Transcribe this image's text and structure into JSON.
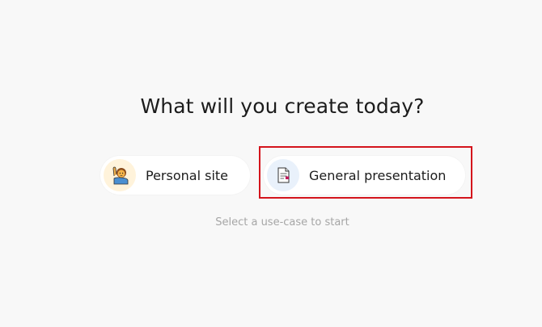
{
  "heading": "What will you create today?",
  "options": [
    {
      "label": "Personal site",
      "icon": "person-raising-hand-icon"
    },
    {
      "label": "General presentation",
      "icon": "document-icon"
    }
  ],
  "hint": "Select a use-case to start",
  "colors": {
    "highlight": "#d4141c",
    "background": "#f8f8f8"
  }
}
